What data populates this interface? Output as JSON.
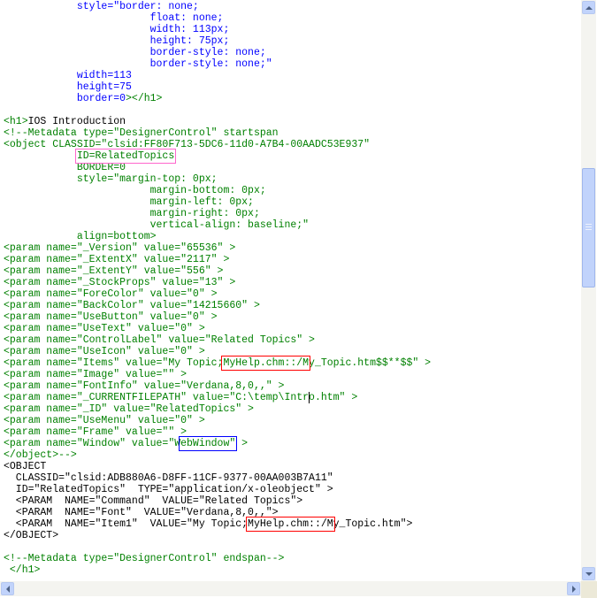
{
  "colors": {
    "text": "#000000",
    "markup": "#008000",
    "value": "#0000ff",
    "highlight_magenta": "#ff66cc",
    "highlight_red": "#ff0000",
    "highlight_blue": "#0000ff"
  },
  "lines": [
    [
      {
        "t": "            style=\"border: none;",
        "c": "value"
      }
    ],
    [
      {
        "t": "                        float: none;",
        "c": "value"
      }
    ],
    [
      {
        "t": "                        width: 113px;",
        "c": "value"
      }
    ],
    [
      {
        "t": "                        height: 75px;",
        "c": "value"
      }
    ],
    [
      {
        "t": "                        border-style: none;",
        "c": "value"
      }
    ],
    [
      {
        "t": "                        border-style: none;\"",
        "c": "value"
      }
    ],
    [
      {
        "t": "            width=113",
        "c": "value"
      }
    ],
    [
      {
        "t": "            height=75",
        "c": "value"
      }
    ],
    [
      {
        "t": "            border=0",
        "c": "value"
      },
      {
        "t": "></h1>",
        "c": "markup"
      }
    ],
    [
      {
        "t": "",
        "c": "text"
      }
    ],
    [
      {
        "t": "<h1>",
        "c": "markup"
      },
      {
        "t": "IOS Introduction",
        "c": "text"
      }
    ],
    [
      {
        "t": "<!--Metadata type=\"DesignerControl\" startspan",
        "c": "markup"
      }
    ],
    [
      {
        "t": "<object CLASSID=\"clsid:FF80F713-5DC6-11d0-A7B4-00AADC53E937\"",
        "c": "markup"
      }
    ],
    [
      {
        "t": "            ID=RelatedTopics",
        "c": "markup"
      }
    ],
    [
      {
        "t": "            BORDER=0",
        "c": "markup"
      }
    ],
    [
      {
        "t": "            style=\"margin-top: 0px;",
        "c": "markup"
      }
    ],
    [
      {
        "t": "                        margin-bottom: 0px;",
        "c": "markup"
      }
    ],
    [
      {
        "t": "                        margin-left: 0px;",
        "c": "markup"
      }
    ],
    [
      {
        "t": "                        margin-right: 0px;",
        "c": "markup"
      }
    ],
    [
      {
        "t": "                        vertical-align: baseline;\"",
        "c": "markup"
      }
    ],
    [
      {
        "t": "            align=bottom>",
        "c": "markup"
      }
    ],
    [
      {
        "t": "<param name=\"_Version\" value=\"65536\" >",
        "c": "markup"
      }
    ],
    [
      {
        "t": "<param name=\"_ExtentX\" value=\"2117\" >",
        "c": "markup"
      }
    ],
    [
      {
        "t": "<param name=\"_ExtentY\" value=\"556\" >",
        "c": "markup"
      }
    ],
    [
      {
        "t": "<param name=\"_StockProps\" value=\"13\" >",
        "c": "markup"
      }
    ],
    [
      {
        "t": "<param name=\"ForeColor\" value=\"0\" >",
        "c": "markup"
      }
    ],
    [
      {
        "t": "<param name=\"BackColor\" value=\"14215660\" >",
        "c": "markup"
      }
    ],
    [
      {
        "t": "<param name=\"UseButton\" value=\"0\" >",
        "c": "markup"
      }
    ],
    [
      {
        "t": "<param name=\"UseText\" value=\"0\" >",
        "c": "markup"
      }
    ],
    [
      {
        "t": "<param name=\"ControlLabel\" value=\"Related Topics\" >",
        "c": "markup"
      }
    ],
    [
      {
        "t": "<param name=\"UseIcon\" value=\"0\" >",
        "c": "markup"
      }
    ],
    [
      {
        "t": "<param name=\"Items\" value=\"My Topic;MyHelp.chm::/My_Topic.htm$$**$$\" >",
        "c": "markup"
      }
    ],
    [
      {
        "t": "<param name=\"Image\" value=\"\" >",
        "c": "markup"
      }
    ],
    [
      {
        "t": "<param name=\"FontInfo\" value=\"Verdana,8,0,,\" >",
        "c": "markup"
      }
    ],
    [
      {
        "t": "<param name=\"_CURRENTFILEPATH\" value=\"C:\\temp\\Intro.htm\" >",
        "c": "markup"
      }
    ],
    [
      {
        "t": "<param name=\"_ID\" value=\"RelatedTopics\" >",
        "c": "markup"
      }
    ],
    [
      {
        "t": "<param name=\"UseMenu\" value=\"0\" >",
        "c": "markup"
      }
    ],
    [
      {
        "t": "<param name=\"Frame\" value=\"\" >",
        "c": "markup"
      }
    ],
    [
      {
        "t": "<param name=\"Window\" value=\"WebWindow\" >",
        "c": "markup"
      }
    ],
    [
      {
        "t": "</object>-->",
        "c": "markup"
      }
    ],
    [
      {
        "t": "<OBJECT",
        "c": "text"
      }
    ],
    [
      {
        "t": "  CLASSID=\"clsid:ADB880A6-D8FF-11CF-9377-00AA003B7A11\"",
        "c": "text"
      }
    ],
    [
      {
        "t": "  ID=\"RelatedTopics\"  TYPE=\"application/x-oleobject\" >",
        "c": "text"
      }
    ],
    [
      {
        "t": "  <PARAM  NAME=\"Command\"  VALUE=\"Related Topics\">",
        "c": "text"
      }
    ],
    [
      {
        "t": "  <PARAM  NAME=\"Font\"  VALUE=\"Verdana,8,0,,\">",
        "c": "text"
      }
    ],
    [
      {
        "t": "  <PARAM  NAME=\"Item1\"  VALUE=\"My Topic;MyHelp.chm::/My_Topic.htm\">",
        "c": "text"
      }
    ],
    [
      {
        "t": "</OBJECT>",
        "c": "text"
      }
    ],
    [
      {
        "t": "",
        "c": "text"
      }
    ],
    [
      {
        "t": "<!--Metadata type=\"DesignerControl\" endspan-->",
        "c": "markup"
      }
    ],
    [
      {
        "t": " </h1>",
        "c": "markup"
      }
    ]
  ],
  "highlights": [
    {
      "name": "id-relatedtopics-highlight",
      "color": "highlight_magenta",
      "line": 13,
      "col": 12,
      "len": 16
    },
    {
      "name": "items-chm-path-highlight",
      "color": "highlight_red",
      "line": 31,
      "col": 36,
      "len": 14
    },
    {
      "name": "webwindow-highlight",
      "color": "highlight_blue",
      "line": 38,
      "col": 29,
      "len": 9
    },
    {
      "name": "item1-chm-path-highlight",
      "color": "highlight_red",
      "line": 45,
      "col": 40,
      "len": 14
    }
  ],
  "caret": {
    "line": 34,
    "col": 50
  },
  "scrollbars": {
    "vertical_up_icon": "arrow-up-icon",
    "vertical_down_icon": "arrow-down-icon",
    "horizontal_left_icon": "arrow-left-icon",
    "horizontal_right_icon": "arrow-right-icon"
  }
}
